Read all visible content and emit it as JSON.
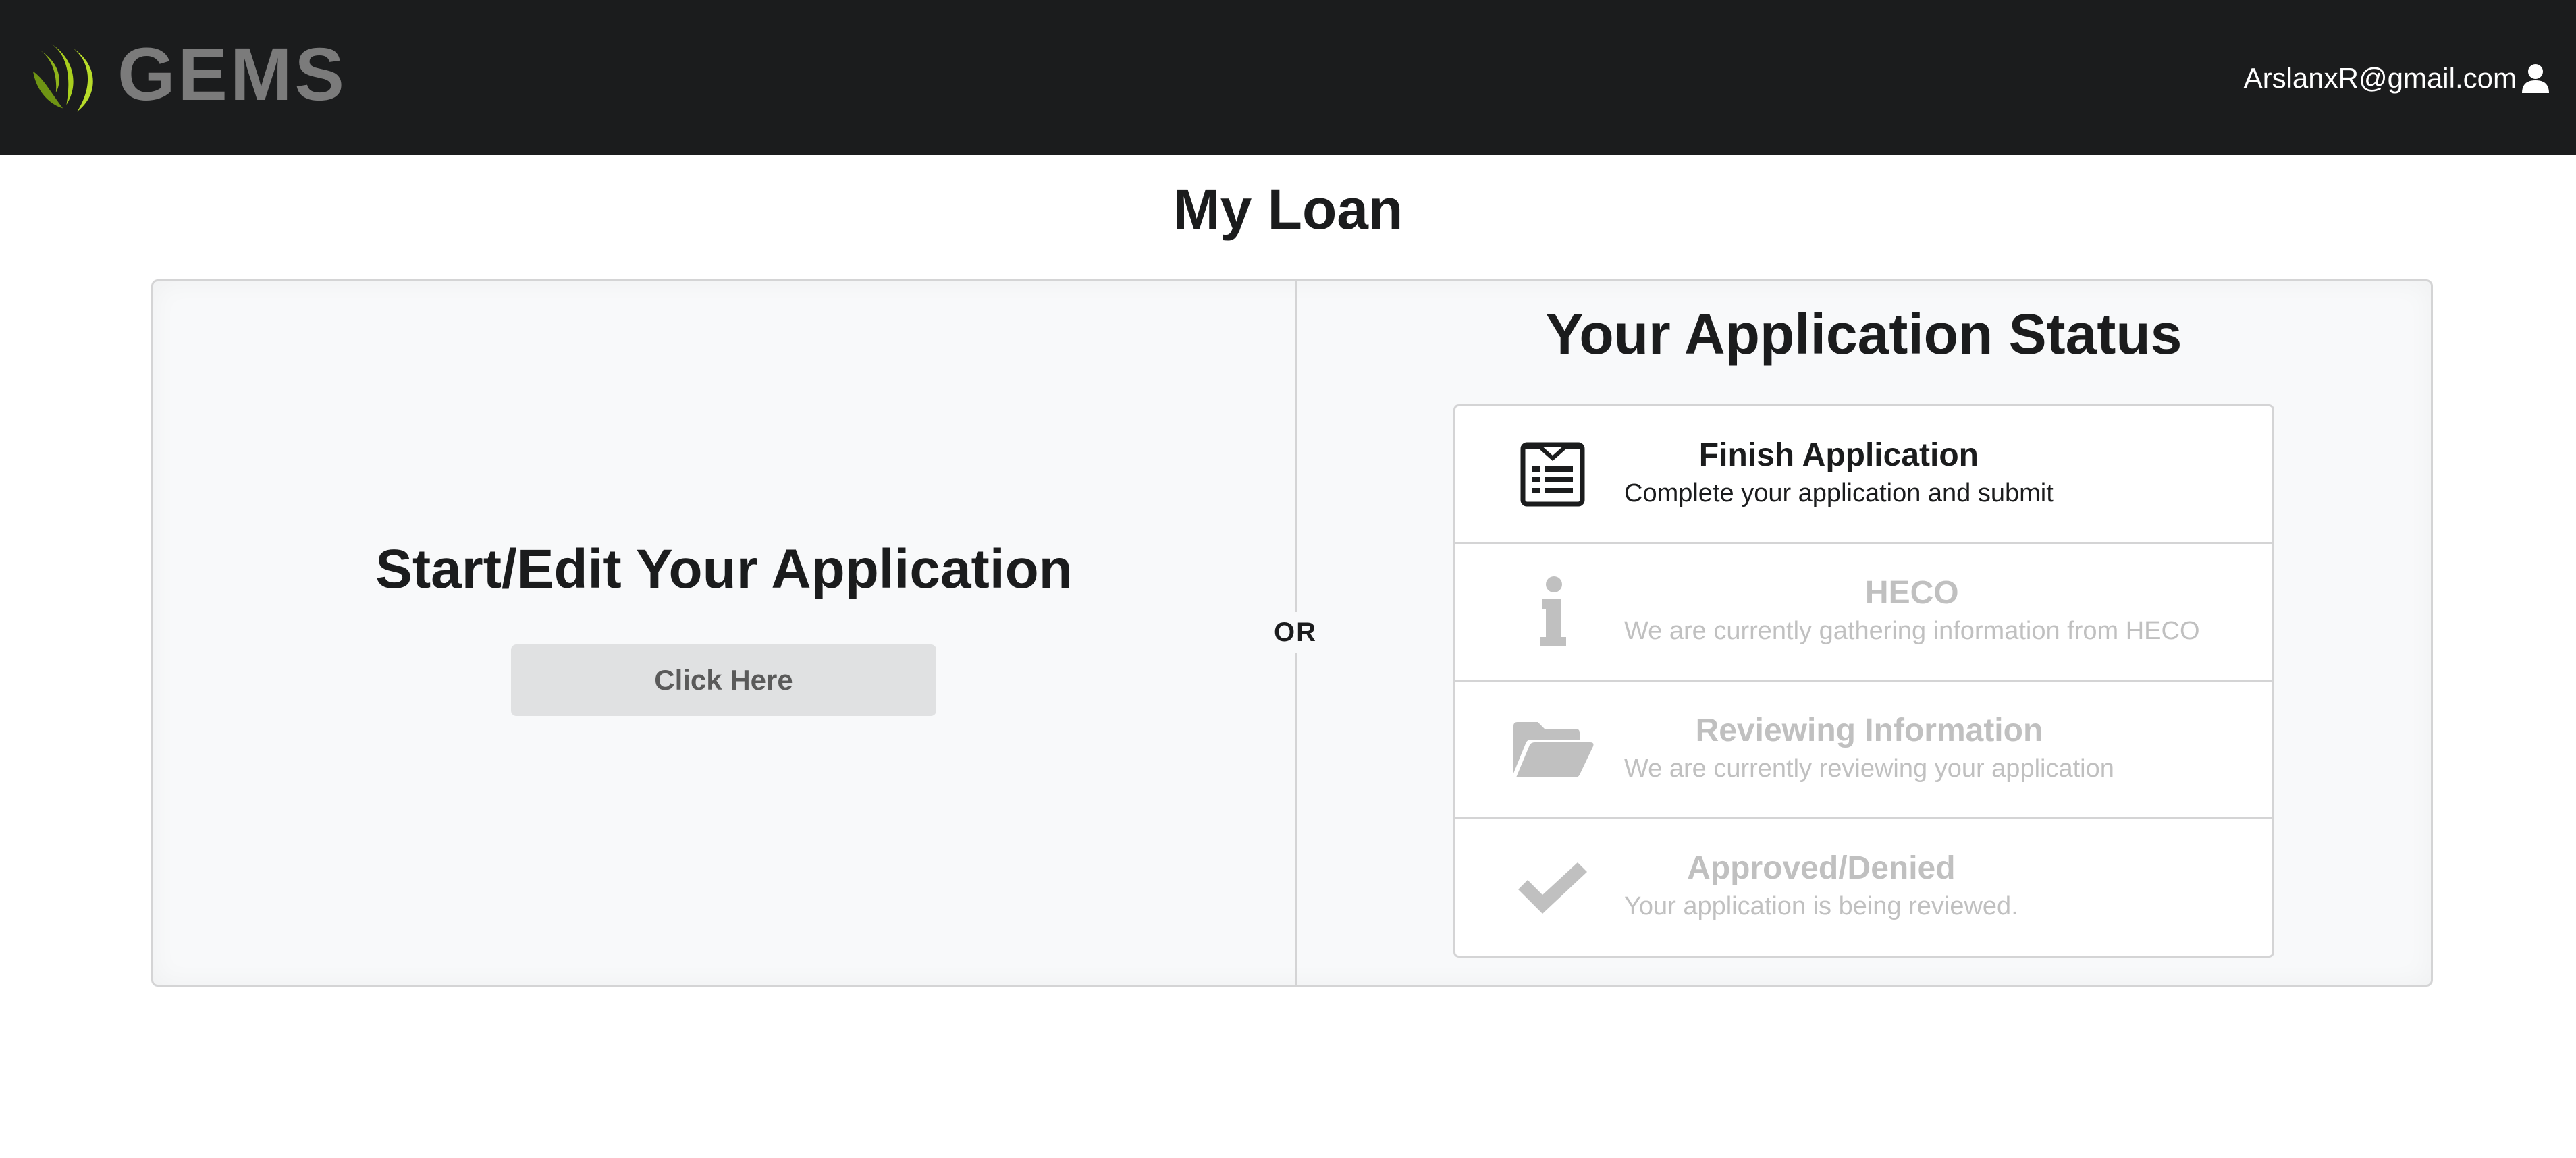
{
  "header": {
    "brand_name": "GEMS",
    "logo_icon": "gems-leaf-logo-icon",
    "user_email": "ArslanxR@gmail.com",
    "user_icon": "user-icon"
  },
  "page": {
    "title": "My Loan"
  },
  "left_panel": {
    "heading": "Start/Edit Your Application",
    "button_label": "Click Here"
  },
  "divider": {
    "label": "OR"
  },
  "right_panel": {
    "heading": "Your Application Status",
    "steps": [
      {
        "title": "Finish Application",
        "description": "Complete your application and submit",
        "icon": "application-form-icon",
        "state": "active"
      },
      {
        "title": "HECO",
        "description": "We are currently gathering information from HECO",
        "icon": "info-icon",
        "state": "disabled"
      },
      {
        "title": "Reviewing Information",
        "description": "We are currently reviewing your application",
        "icon": "open-folder-icon",
        "state": "disabled"
      },
      {
        "title": "Approved/Denied",
        "description": "Your application is being reviewed.",
        "icon": "checkmark-icon",
        "state": "disabled"
      }
    ]
  },
  "colors": {
    "header_bg": "#1b1c1d",
    "brand_green": "#9bc31a",
    "brand_gray": "#7b7b7b",
    "segment_bg": "#f8f9fa",
    "button_bg": "#e0e1e2",
    "disabled_text": "#c0c0c0"
  }
}
